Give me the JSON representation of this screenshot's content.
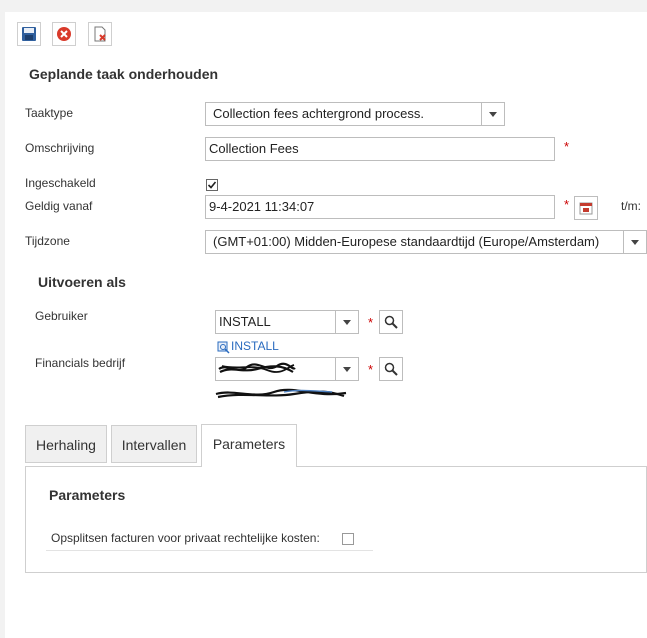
{
  "toolbar": {
    "save_icon": "save-icon",
    "cancel_icon": "cancel-icon",
    "delete_icon": "delete-document-icon"
  },
  "page_title": "Geplande taak onderhouden",
  "form": {
    "taaktype": {
      "label": "Taaktype",
      "value": "Collection fees achtergrond process."
    },
    "omschrijving": {
      "label": "Omschrijving",
      "value": "Collection Fees",
      "required": "*"
    },
    "ingeschakeld": {
      "label": "Ingeschakeld",
      "checked": true
    },
    "geldig_vanaf": {
      "label": "Geldig vanaf",
      "value": "9-4-2021 11:34:07",
      "required": "*",
      "until_label": "t/m:"
    },
    "tijdzone": {
      "label": "Tijdzone",
      "value": "(GMT+01:00) Midden-Europese standaardtijd (Europe/Amsterdam)"
    }
  },
  "run_as": {
    "title": "Uitvoeren als",
    "gebruiker": {
      "label": "Gebruiker",
      "value": "INSTALL",
      "required": "*",
      "link": "INSTALL"
    },
    "financials": {
      "label": "Financials bedrijf",
      "required": "*"
    }
  },
  "tabs": [
    {
      "label": "Herhaling"
    },
    {
      "label": "Intervallen"
    },
    {
      "label": "Parameters",
      "active": true
    }
  ],
  "parameters": {
    "title": "Parameters",
    "split_label": "Opsplitsen facturen voor privaat rechtelijke kosten:",
    "split_checked": false
  },
  "colors": {
    "link": "#2a6bbf",
    "required": "#cc0000",
    "border": "#bdbdbd"
  }
}
